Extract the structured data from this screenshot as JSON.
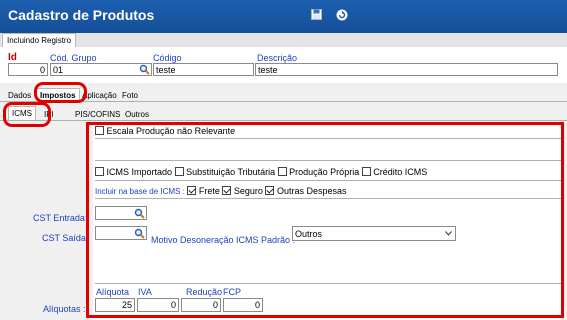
{
  "window": {
    "title": "Cadastro de Produtos"
  },
  "mode_tab": "Incluindo Registro",
  "header": {
    "id_label": "Id",
    "id_value": "0",
    "grupo_label": "Cód. Grupo",
    "grupo_value": "01",
    "codigo_label": "Código",
    "codigo_value": "teste",
    "descricao_label": "Descrição",
    "descricao_value": "teste"
  },
  "main_tabs": [
    "Dados",
    "Impostos",
    "Aplicação",
    "Foto"
  ],
  "sub_tabs": [
    "ICMS",
    "IPI",
    "PIS/COFINS",
    "Outros"
  ],
  "icms": {
    "escala_label": "Escala Produção não Relevante",
    "flags": [
      "ICMS Importado",
      "Substituição Tributária",
      "Produção Própria",
      "Crédito ICMS"
    ],
    "base_label": "Incluir na base de ICMS :",
    "base_items": [
      "Frete",
      "Seguro",
      "Outras Despesas"
    ],
    "cst_entrada_label": "CST Entrada:",
    "cst_saida_label": "CST Saída:",
    "motivo_label": "Motivo Desoneração ICMS Padrão :",
    "motivo_value": "Outros",
    "aliquotas_label": "Alíquotas :",
    "rates_headers": [
      "Alíquota",
      "IVA",
      "Redução",
      "FCP"
    ],
    "rates_values": [
      "25",
      "0",
      "0",
      "0"
    ]
  },
  "colors": {
    "title_bg": "#1c5fae",
    "label_blue": "#1f3fbf",
    "label_red": "#c00000",
    "annotation_red": "#e00000"
  },
  "icons": [
    "save-icon",
    "refresh-icon",
    "zoom-icon",
    "chevron-down-icon"
  ]
}
